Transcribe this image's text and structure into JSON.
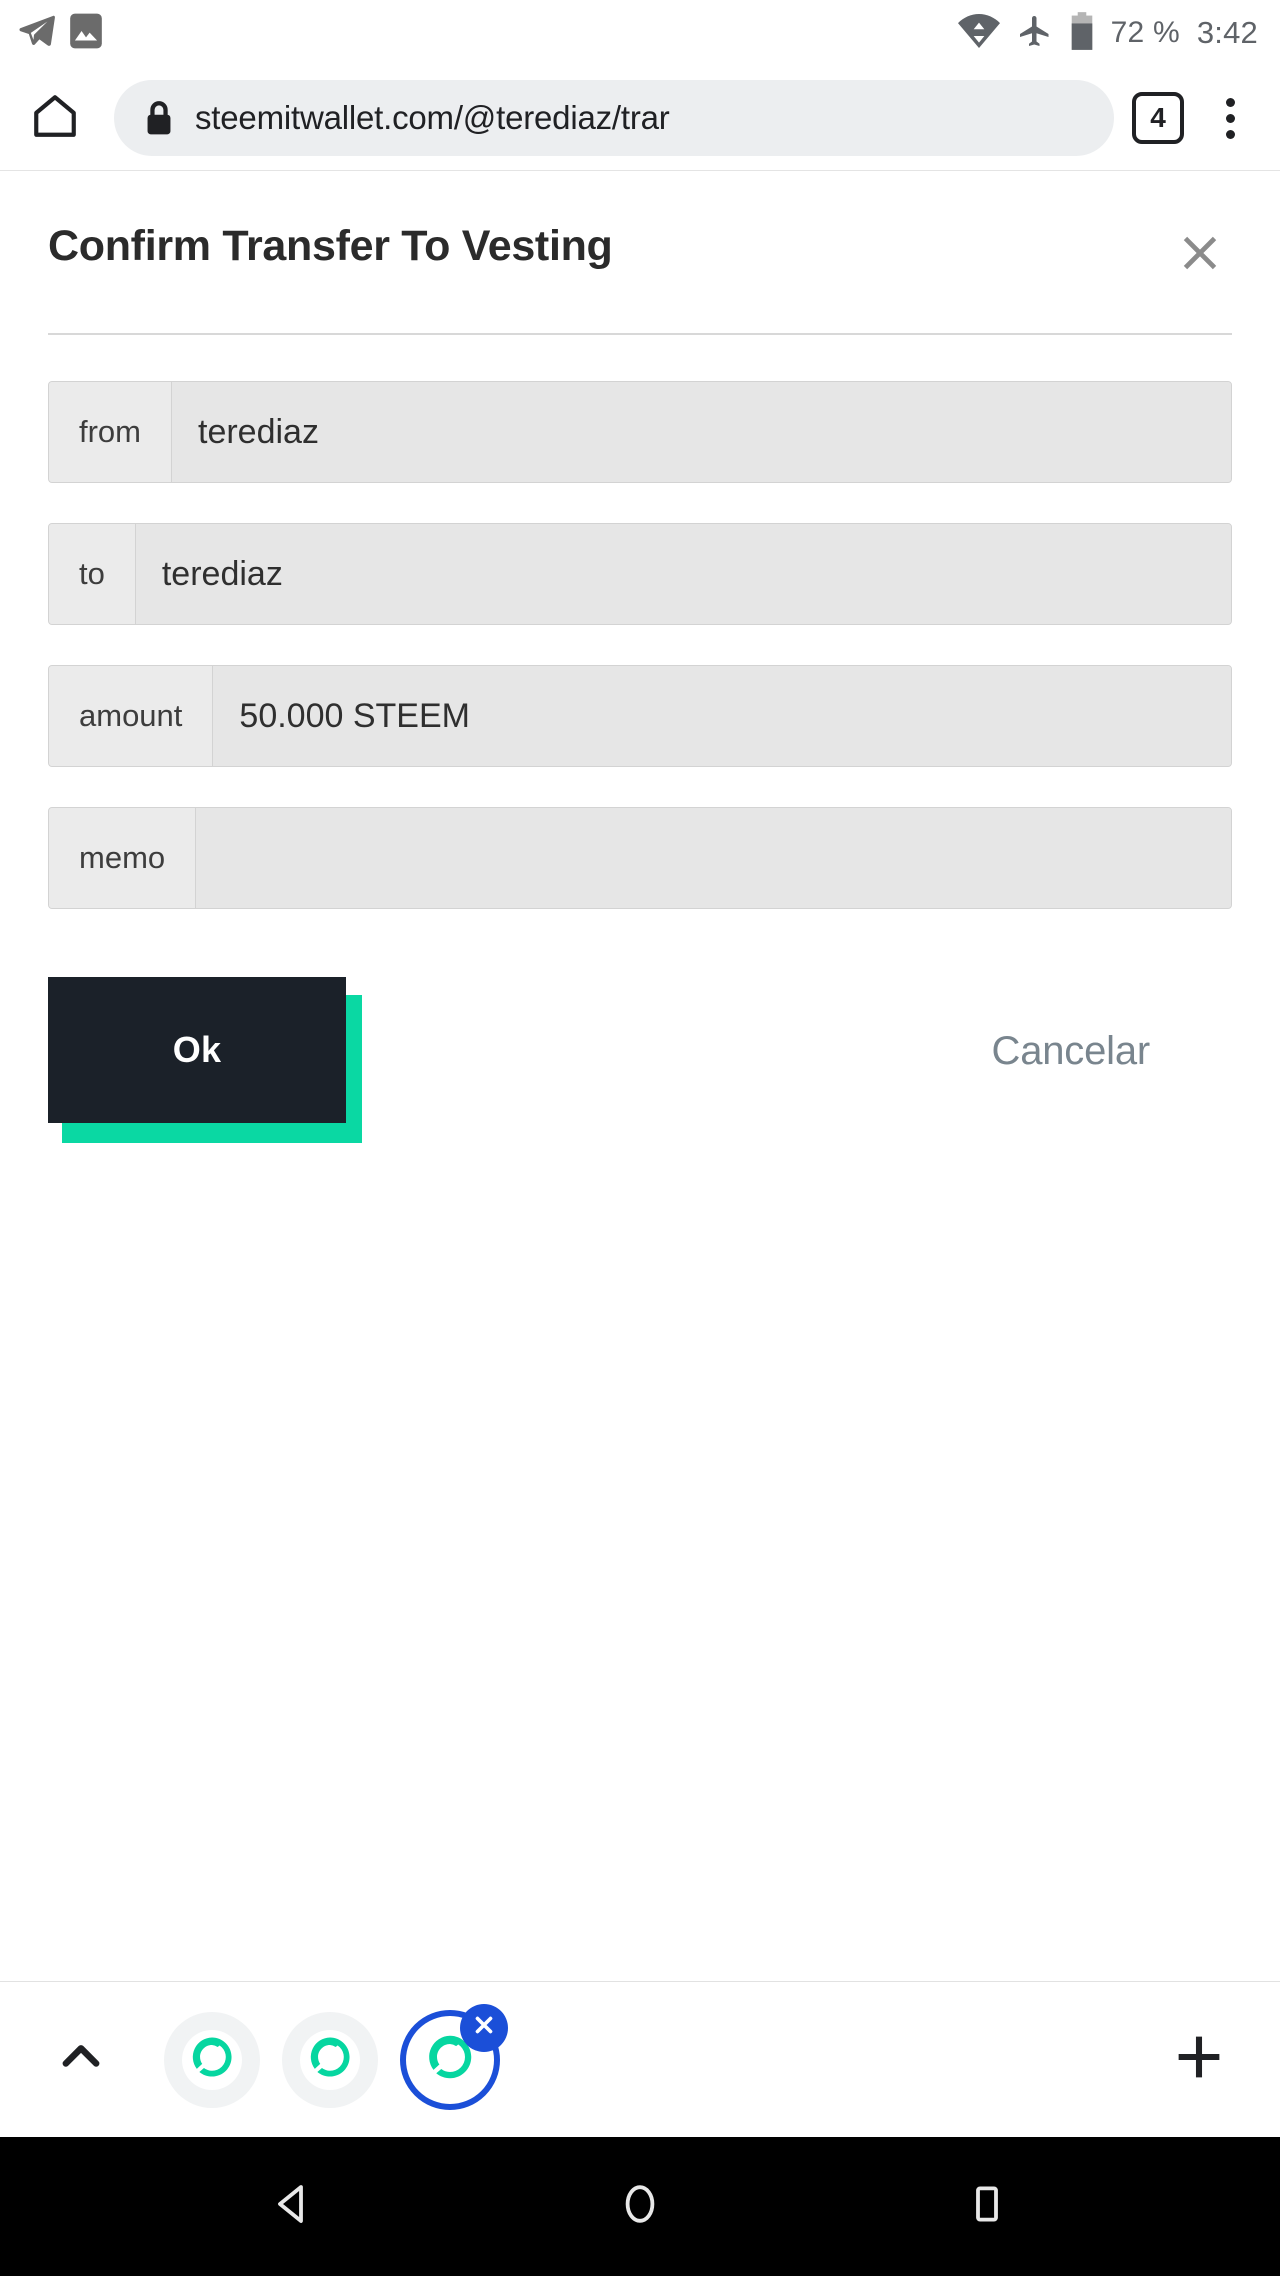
{
  "status_bar": {
    "icons": [
      "telegram-icon",
      "photos-icon",
      "wifi-icon",
      "airplane-mode-icon",
      "battery-icon"
    ],
    "battery": "72 %",
    "clock": "3:42"
  },
  "browser": {
    "home_icon": "home-icon",
    "lock_icon": "lock-icon",
    "url": "steemitwallet.com/@terediaz/trar",
    "tab_count": "4",
    "menu_icon": "overflow-menu-icon"
  },
  "dialog": {
    "title": "Confirm Transfer To Vesting",
    "close_icon": "close-icon",
    "fields": [
      {
        "label": "from",
        "value": "terediaz"
      },
      {
        "label": "to",
        "value": "terediaz"
      },
      {
        "label": "amount",
        "value": "50.000 STEEM"
      },
      {
        "label": "memo",
        "value": ""
      }
    ],
    "ok_label": "Ok",
    "cancel_label": "Cancelar"
  },
  "tabstrip": {
    "expand_icon": "chevron-up-icon",
    "tabs": [
      {
        "favicon": "steem-logo-icon",
        "selected": false
      },
      {
        "favicon": "steem-logo-icon",
        "selected": false
      },
      {
        "favicon": "steem-logo-icon",
        "selected": true,
        "close_icon": "close-tab-icon"
      }
    ],
    "new_tab_icon": "plus-icon"
  },
  "navbar": {
    "back_icon": "back-triangle-icon",
    "home_icon": "home-circle-icon",
    "recents_icon": "recents-square-icon"
  },
  "colors": {
    "accent_teal": "#0ad8a3",
    "button_dark": "#1b2129",
    "tab_blue": "#1b4fd8",
    "cancel_gray": "#79858e",
    "field_bg": "#e6e6e6"
  }
}
